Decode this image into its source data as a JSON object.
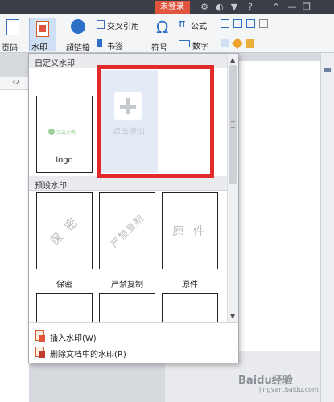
{
  "titlebar": {
    "login_label": "未登录",
    "icons": [
      "gear-icon",
      "skin-icon",
      "shirt-icon",
      "help-icon",
      "chevron-up-icon",
      "minimize-icon",
      "restore-icon"
    ]
  },
  "ribbon": {
    "page_number_label": "页码",
    "watermark_label": "水印",
    "hyperlink_label": "超链接",
    "cross_ref_label": "交叉引用",
    "bookmark_label": "书签",
    "symbol_label": "符号",
    "formula_label": "公式",
    "number_label": "数字"
  },
  "ruler": {
    "number": "32"
  },
  "watermark_panel": {
    "custom_header": "自定义水印",
    "custom_items": [
      {
        "label": "logo",
        "preview_text": "汉云大略"
      }
    ],
    "add_label": "点击添加",
    "preset_header": "预设水印",
    "presets": [
      {
        "label": "保密",
        "preview_text": "保 密"
      },
      {
        "label": "严禁复制",
        "preview_text": "严禁复制"
      },
      {
        "label": "原件",
        "preview_text": "原 件"
      }
    ],
    "insert_label": "插入水印(W)",
    "delete_label": "删除文档中的水印(R)"
  },
  "colors": {
    "highlight": "#e32a2a",
    "login_bg": "#e0533c",
    "accent": "#2b6fc6"
  },
  "baidu": {
    "logo": "Baidu经验",
    "sub": "jingyan.baidu.com"
  }
}
